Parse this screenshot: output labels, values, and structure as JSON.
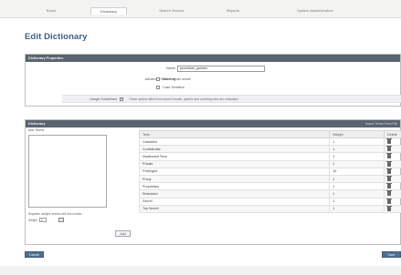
{
  "nav": {
    "tabs": [
      {
        "label": "Home",
        "active": false
      },
      {
        "label": "Dictionary",
        "active": true
      },
      {
        "label": "Search Service",
        "active": false
      },
      {
        "label": "Reports",
        "active": false
      },
      {
        "label": "System Administration",
        "active": false
      }
    ]
  },
  "page": {
    "title": "Edit Dictionary"
  },
  "properties": {
    "header": "Dictionary Properties",
    "name_label": "Name",
    "name_value": "procedure_queries",
    "advanced_label": "Advanced Matching",
    "match_whole_words": "Match whole words",
    "case_sensitive": "Case Sensitive",
    "help_label": "Usage Guidelines",
    "help_icon": "?",
    "help_text": "These options affect how search results, queries and counting rules are evaluated."
  },
  "terms_panel": {
    "header": "Dictionary",
    "header_link": "Import Terms From File",
    "add_terms_label": "Add Terms",
    "instructions": "Separate multiple entries with line breaks.",
    "weight_label": "Weight",
    "weight_value": "1",
    "add_button": "Add",
    "columns": [
      "Term",
      "Weight",
      "Delete"
    ],
    "rows": [
      {
        "term": "Classified",
        "weight": "1"
      },
      {
        "term": "Confidential",
        "weight": "1"
      },
      {
        "term": "Disallowed Term",
        "weight": "1"
      },
      {
        "term": "Private",
        "weight": "1"
      },
      {
        "term": "Privileged",
        "weight": "10"
      },
      {
        "term": "Proxy",
        "weight": "1"
      },
      {
        "term": "Proprietary",
        "weight": "1"
      },
      {
        "term": "Restricted",
        "weight": "1"
      },
      {
        "term": "Secret",
        "weight": "1"
      },
      {
        "term": "Top Secret",
        "weight": "1"
      }
    ]
  },
  "footer": {
    "cancel_label": "Cancel",
    "save_label": "Save"
  }
}
